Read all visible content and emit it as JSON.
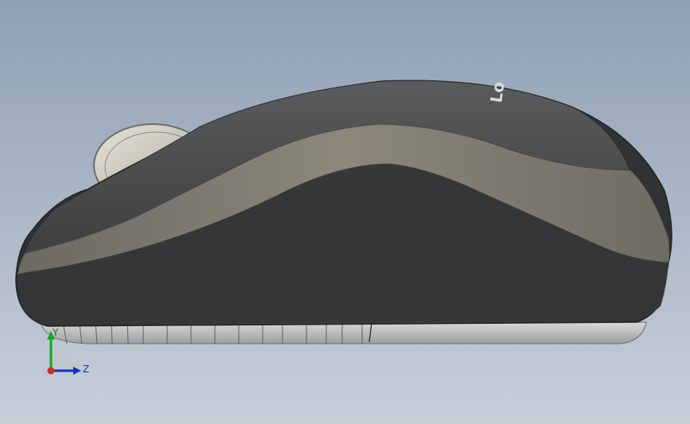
{
  "viewport": {
    "background_top": "#8fa0b4",
    "background_bottom": "#c7cfd9"
  },
  "model": {
    "shell_color": "#474849",
    "stripe_color": "#858072",
    "base_color": "#c4c6c6",
    "wheel_color": "#cfccc0",
    "logo_text": "Lo"
  },
  "triad": {
    "y_label": "Y",
    "z_label": "Z",
    "y_color": "#11aa22",
    "z_color": "#1133cc",
    "origin_color": "#dd2222"
  }
}
